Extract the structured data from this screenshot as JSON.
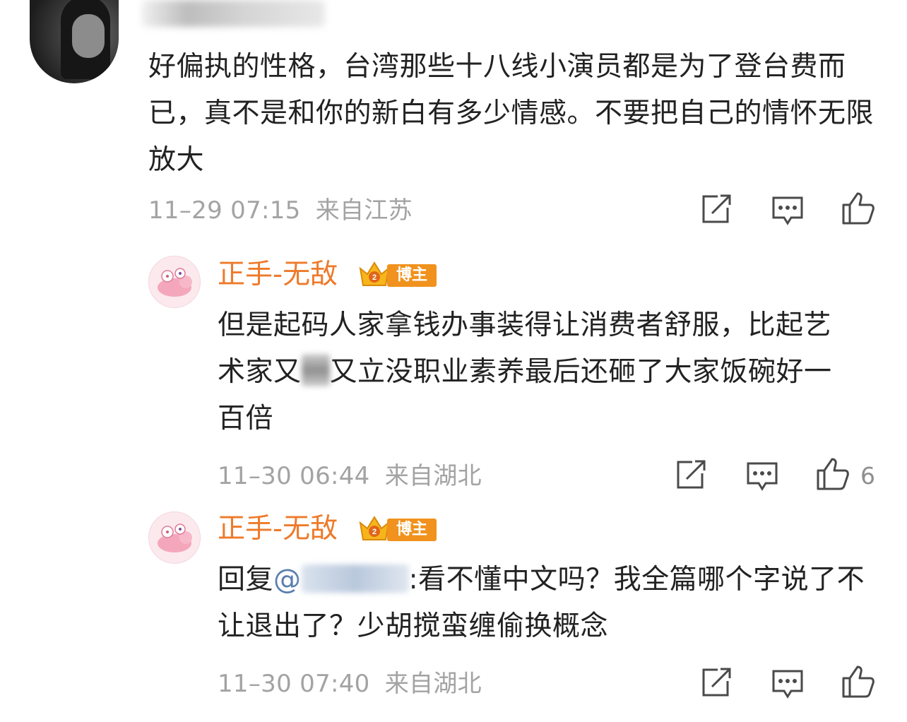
{
  "comment": {
    "text": "好偏执的性格，台湾那些十八线小演员都是为了登台费而已，真不是和你的新白有多少情感。不要把自己的情怀无限放大",
    "timestamp": "11–29 07:15",
    "location": "来自江苏",
    "like_count": ""
  },
  "replies": [
    {
      "username": "正手-无敌",
      "badge": "博主",
      "text_before_blur": "但是起码人家拿钱办事装得让消费者舒服，比起艺术家又",
      "text_after_blur": "又立没职业素养最后还砸了大家饭碗好一百倍",
      "timestamp": "11–30 06:44",
      "location": "来自湖北",
      "like_count": "6"
    },
    {
      "username": "正手-无敌",
      "badge": "博主",
      "reply_prefix": "回复",
      "mention_at": "@",
      "text": ":看不懂中文吗？我全篇哪个字说了不让退出了？少胡搅蛮缠偷换概念",
      "timestamp": "11–30 07:40",
      "location": "来自湖北",
      "like_count": ""
    }
  ],
  "icons": {
    "share": "share-icon",
    "comment": "comment-icon",
    "like": "thumbs-up-icon"
  },
  "colors": {
    "username": "#ee7a2a",
    "mention": "#5b7fae",
    "meta": "#a3a3a3",
    "badge": "#f0921d"
  }
}
